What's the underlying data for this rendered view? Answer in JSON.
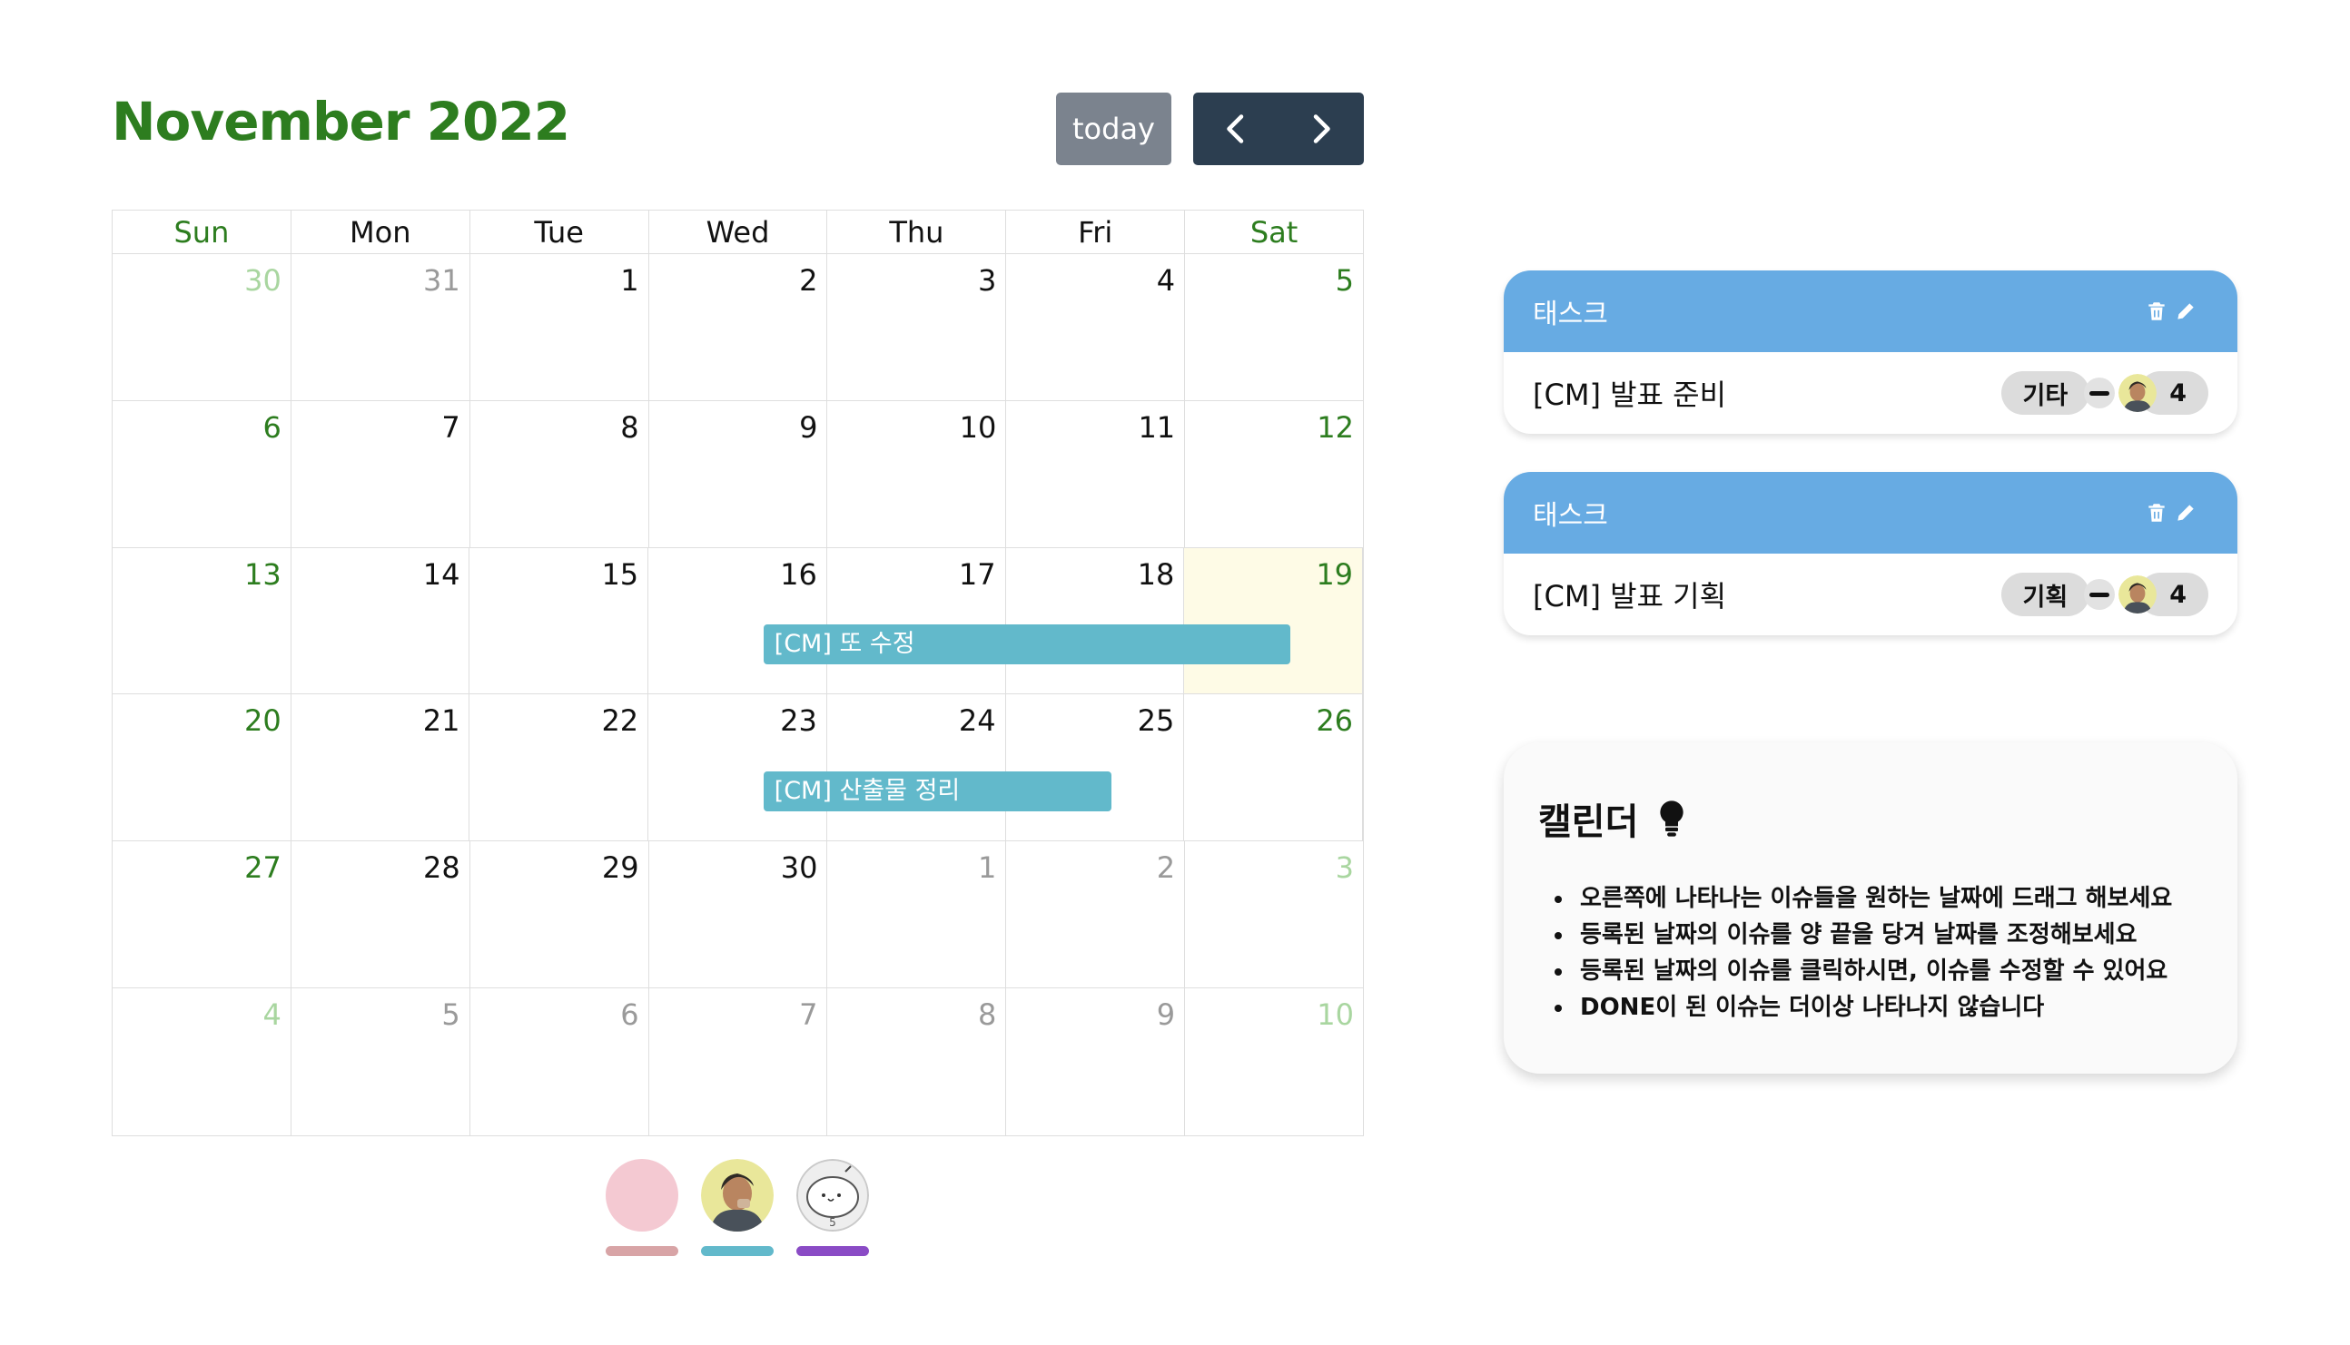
{
  "calendar": {
    "title": "November 2022",
    "today_label": "today",
    "weekdays": [
      "Sun",
      "Mon",
      "Tue",
      "Wed",
      "Thu",
      "Fri",
      "Sat"
    ],
    "weeks": [
      [
        "30",
        "31",
        "1",
        "2",
        "3",
        "4",
        "5"
      ],
      [
        "6",
        "7",
        "8",
        "9",
        "10",
        "11",
        "12"
      ],
      [
        "13",
        "14",
        "15",
        "16",
        "17",
        "18",
        "19"
      ],
      [
        "20",
        "21",
        "22",
        "23",
        "24",
        "25",
        "26"
      ],
      [
        "27",
        "28",
        "29",
        "30",
        "1",
        "2",
        "3"
      ],
      [
        "4",
        "5",
        "6",
        "7",
        "8",
        "9",
        "10"
      ]
    ],
    "today_date": "19",
    "events": [
      {
        "title": "[CM] 또 수정"
      },
      {
        "title": "[CM] 산출물 정리"
      }
    ],
    "avatar_colors": [
      "#f4c9d2",
      "#62b9cb",
      "#8a4bc5"
    ]
  },
  "tasks": [
    {
      "header": "태스크",
      "title": "[CM] 발표 준비",
      "category": "기타",
      "count": "4"
    },
    {
      "header": "태스크",
      "title": "[CM] 발표 기획",
      "category": "기획",
      "count": "4"
    }
  ],
  "help": {
    "title": "캘린더",
    "items": [
      "오른쪽에 나타나는 이슈들을 원하는 날짜에 드래그 해보세요",
      "등록된 날짜의 이슈를 양 끝을 당겨 날짜를 조정해보세요",
      "등록된 날짜의 이슈를 클릭하시면, 이슈를 수정할 수 있어요",
      "DONE이 된 이슈는 더이상 나타나지 않습니다"
    ]
  },
  "colors": {
    "accent_green": "#2d7d1f",
    "event_teal": "#62b9cb",
    "task_header_blue": "#67abe3",
    "today_bg": "#fefbe6"
  }
}
